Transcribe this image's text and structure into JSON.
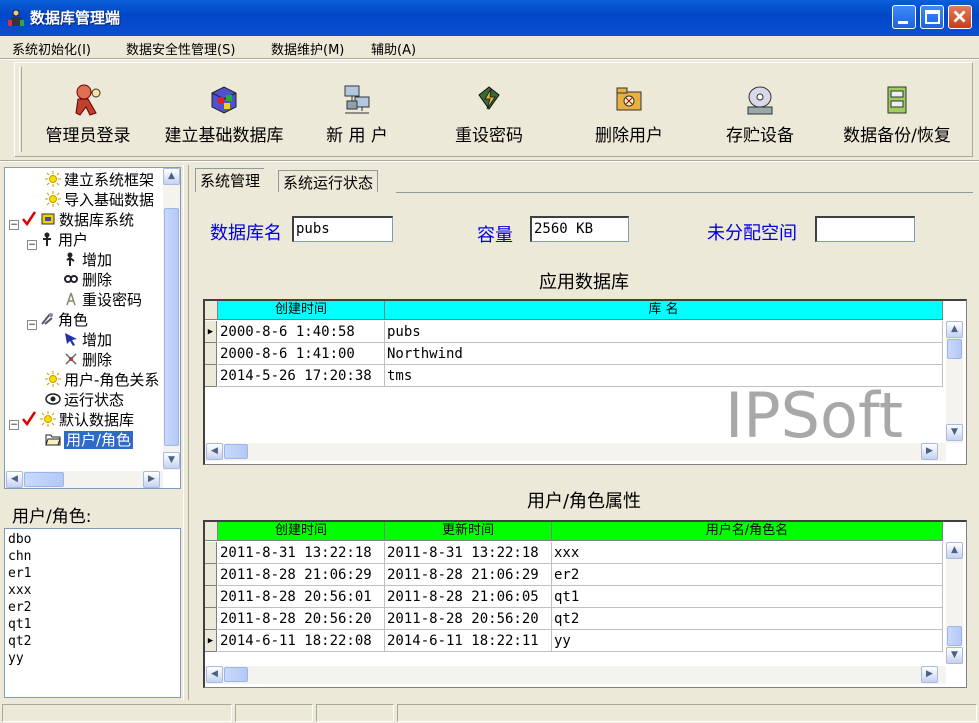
{
  "window": {
    "title": "数据库管理端"
  },
  "menu": [
    "系统初始化(I)",
    "数据安全性管理(S)",
    "数据维护(M)",
    "辅助(A)"
  ],
  "toolbar": [
    {
      "label": "管理员登录",
      "icon": "admin-login-icon"
    },
    {
      "label": "建立基础数据库",
      "icon": "create-database-icon"
    },
    {
      "label": "新 用 户",
      "icon": "new-user-icon"
    },
    {
      "label": "重设密码",
      "icon": "reset-password-icon"
    },
    {
      "label": "删除用户",
      "icon": "delete-user-icon"
    },
    {
      "label": "存贮设备",
      "icon": "storage-device-icon"
    },
    {
      "label": "数据备份/恢复",
      "icon": "backup-restore-icon"
    }
  ],
  "tree": {
    "nodes": [
      {
        "label": "建立系统框架"
      },
      {
        "label": "导入基础数据"
      },
      {
        "label": "数据库系统"
      },
      {
        "label": "用户"
      },
      {
        "label": "增加"
      },
      {
        "label": "删除"
      },
      {
        "label": "重设密码"
      },
      {
        "label": "角色"
      },
      {
        "label": "增加"
      },
      {
        "label": "删除"
      },
      {
        "label": "用户-角色关系"
      },
      {
        "label": "运行状态"
      },
      {
        "label": "默认数据库"
      },
      {
        "label": "用户/角色"
      }
    ]
  },
  "user_role_panel": {
    "label": "用户/角色:",
    "items": [
      "dbo",
      "chn",
      "er1",
      "xxx",
      "er2",
      "qt1",
      "qt2",
      "yy"
    ]
  },
  "tabs": [
    "系统管理",
    "系统运行状态"
  ],
  "fields": {
    "db_name_label": "数据库名",
    "db_name_value": "pubs",
    "capacity_label": "容量",
    "capacity_value": "2560 KB",
    "unallocated_label": "未分配空间",
    "unallocated_value": ""
  },
  "app_db": {
    "title": "应用数据库",
    "columns": [
      "创建时间",
      "库 名"
    ],
    "rows": [
      [
        "2000-8-6 1:40:58",
        "pubs"
      ],
      [
        "2000-8-6 1:41:00",
        "Northwind"
      ],
      [
        "2014-5-26 17:20:38",
        "tms"
      ]
    ],
    "header_color": "#00ffff"
  },
  "watermark": "IPSoft",
  "user_props": {
    "title": "用户/角色属性",
    "columns": [
      "创建时间",
      "更新时间",
      "用户名/角色名"
    ],
    "rows": [
      [
        "2011-8-31 13:22:18",
        "2011-8-31 13:22:18",
        "xxx"
      ],
      [
        "2011-8-28 21:06:29",
        "2011-8-28 21:06:29",
        "er2"
      ],
      [
        "2011-8-28 20:56:01",
        "2011-8-28 21:06:05",
        "qt1"
      ],
      [
        "2011-8-28 20:56:20",
        "2011-8-28 20:56:20",
        "qt2"
      ],
      [
        "2014-6-11 18:22:08",
        "2014-6-11 18:22:11",
        "yy"
      ]
    ],
    "header_color": "#00ff00"
  }
}
